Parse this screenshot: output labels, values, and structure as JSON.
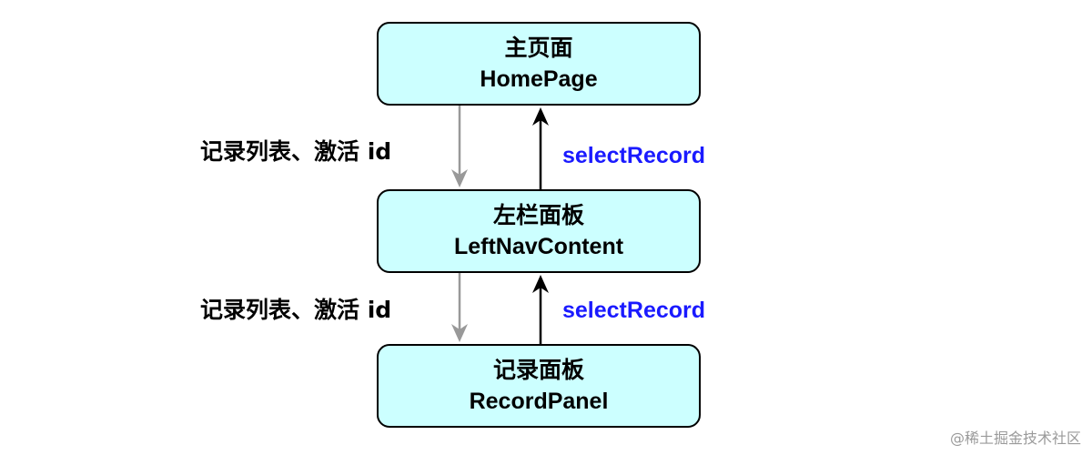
{
  "nodes": {
    "home": {
      "title": "主页面",
      "subtitle": "HomePage"
    },
    "left_nav": {
      "title": "左栏面板",
      "subtitle": "LeftNavContent"
    },
    "record": {
      "title": "记录面板",
      "subtitle": "RecordPanel"
    }
  },
  "edges": {
    "home_to_left_down": "记录列表、激活 id",
    "left_to_home_up": "selectRecord",
    "left_to_record_down": "记录列表、激活 id",
    "record_to_left_up": "selectRecord"
  },
  "watermark": "@稀土掘金技术社区",
  "colors": {
    "node_fill": "#ccffff",
    "node_border": "#000000",
    "down_arrow": "#999999",
    "up_arrow": "#000000",
    "up_label": "#1a1aff"
  }
}
